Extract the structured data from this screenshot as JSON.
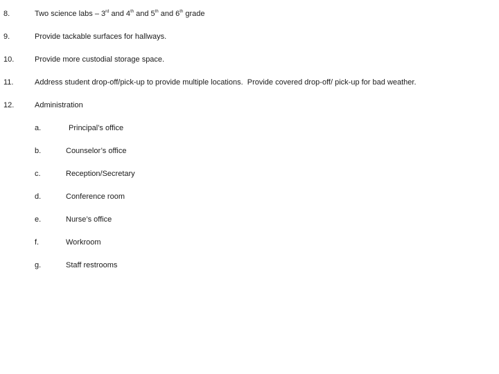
{
  "document": {
    "items": [
      {
        "number": "8.",
        "parts": [
          {
            "text": "Two science labs – 3"
          },
          {
            "sup": "rd"
          },
          {
            "text": " and 4"
          },
          {
            "sup": "th"
          },
          {
            "text": " and 5"
          },
          {
            "sup": "th"
          },
          {
            "text": " and 6"
          },
          {
            "sup": "th"
          },
          {
            "text": " grade"
          }
        ]
      },
      {
        "number": "9.",
        "text": "Provide tackable surfaces for hallways."
      },
      {
        "number": "10.",
        "text": "Provide more custodial storage space."
      },
      {
        "number": "11.",
        "text": "Address student drop-off/pick-up to provide multiple locations.  Provide covered drop-off/ pick-up for bad weather."
      },
      {
        "number": "12.",
        "text": "Administration"
      }
    ],
    "administration_subitems": [
      {
        "letter": "a.",
        "text": "Principal’s office"
      },
      {
        "letter": "b.",
        "text": "Counselor’s office"
      },
      {
        "letter": "c.",
        "text": "Reception/Secretary"
      },
      {
        "letter": "d.",
        "text": "Conference room"
      },
      {
        "letter": "e.",
        "text": "Nurse’s office"
      },
      {
        "letter": "f.",
        "text": "Workroom"
      },
      {
        "letter": "g.",
        "text": "Staff restrooms"
      }
    ]
  }
}
